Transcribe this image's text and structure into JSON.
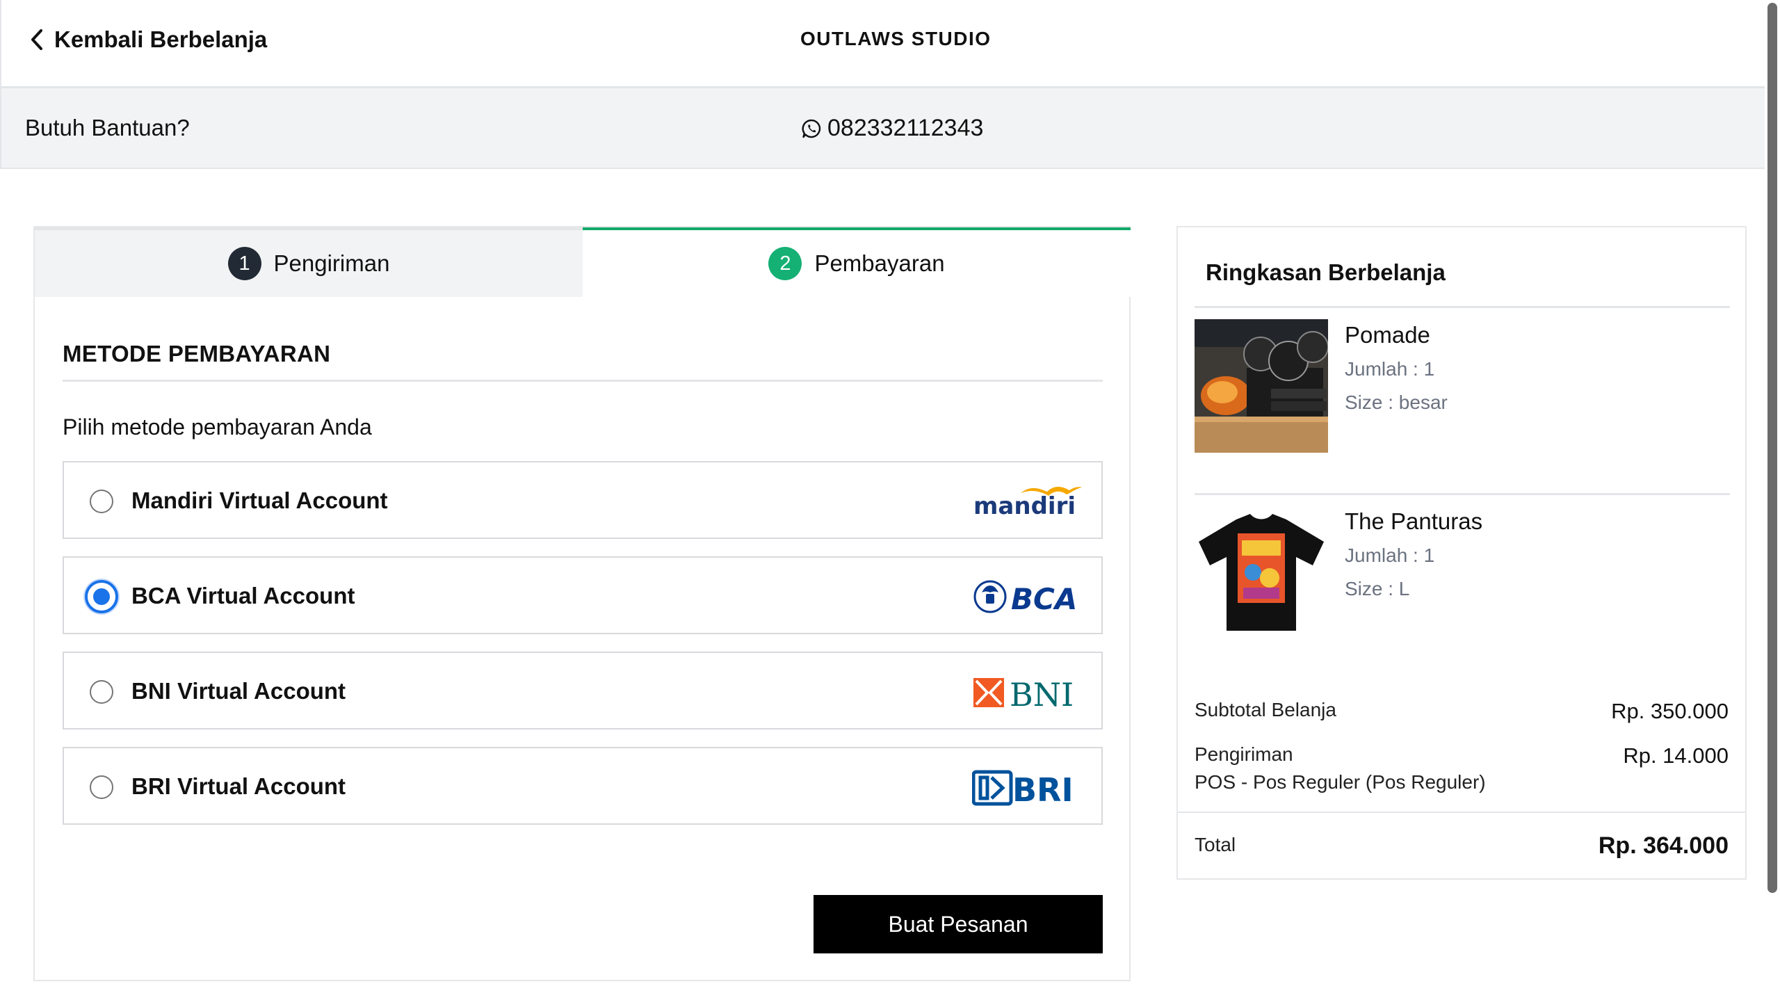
{
  "header": {
    "back_label": "Kembali Berbelanja",
    "store_name": "OUTLAWS STUDIO"
  },
  "help": {
    "label": "Butuh Bantuan?",
    "whatsapp_number": "082332112343"
  },
  "steps": [
    {
      "number": "1",
      "label": "Pengiriman",
      "state": "done"
    },
    {
      "number": "2",
      "label": "Pembayaran",
      "state": "active"
    }
  ],
  "payment": {
    "section_title": "METODE PEMBAYARAN",
    "instruction": "Pilih metode pembayaran Anda",
    "options": [
      {
        "label": "Mandiri Virtual Account",
        "logo_text": "mandiri",
        "selected": false
      },
      {
        "label": "BCA Virtual Account",
        "logo_text": "BCA",
        "selected": true
      },
      {
        "label": "BNI Virtual Account",
        "logo_text": "BNI",
        "selected": false
      },
      {
        "label": "BRI Virtual Account",
        "logo_text": "BRI",
        "selected": false
      }
    ],
    "submit_label": "Buat Pesanan"
  },
  "summary": {
    "title": "Ringkasan Berbelanja",
    "items": [
      {
        "name": "Pomade",
        "qty_label": "Jumlah : 1",
        "size_label": "Size : besar",
        "image_icon": "pomade-product-photo"
      },
      {
        "name": "The Panturas",
        "qty_label": "Jumlah : 1",
        "size_label": "Size : L",
        "image_icon": "tshirt-product-photo"
      }
    ],
    "subtotal_label": "Subtotal Belanja",
    "subtotal_value": "Rp. 350.000",
    "shipping_label": "Pengiriman",
    "shipping_service": "POS - Pos Reguler (Pos Reguler)",
    "shipping_value": "Rp. 14.000",
    "total_label": "Total",
    "total_value": "Rp. 364.000"
  },
  "colors": {
    "accent_green": "#15b074",
    "radio_blue": "#1a73e8",
    "button_black": "#000000"
  }
}
